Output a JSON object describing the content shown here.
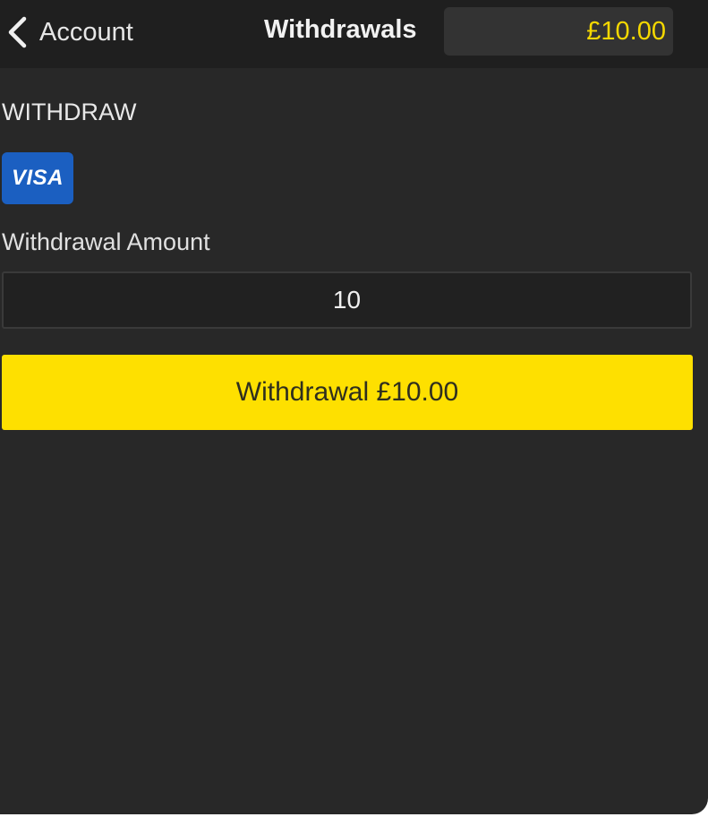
{
  "header": {
    "back_label": "Account",
    "title": "Withdrawals",
    "balance": "£10.00"
  },
  "withdraw": {
    "heading": "WITHDRAW",
    "card_brand": "VISA",
    "amount_label": "Withdrawal Amount",
    "amount_value": "10",
    "button_label": "Withdrawal £10.00"
  },
  "colors": {
    "background": "#282828",
    "header_background": "#1f1f1f",
    "accent_yellow": "#fee000",
    "balance_text": "#f5d800",
    "visa_blue": "#1b5fc1"
  },
  "icons": {
    "back": "chevron-left-icon",
    "card": "visa-card-icon"
  }
}
